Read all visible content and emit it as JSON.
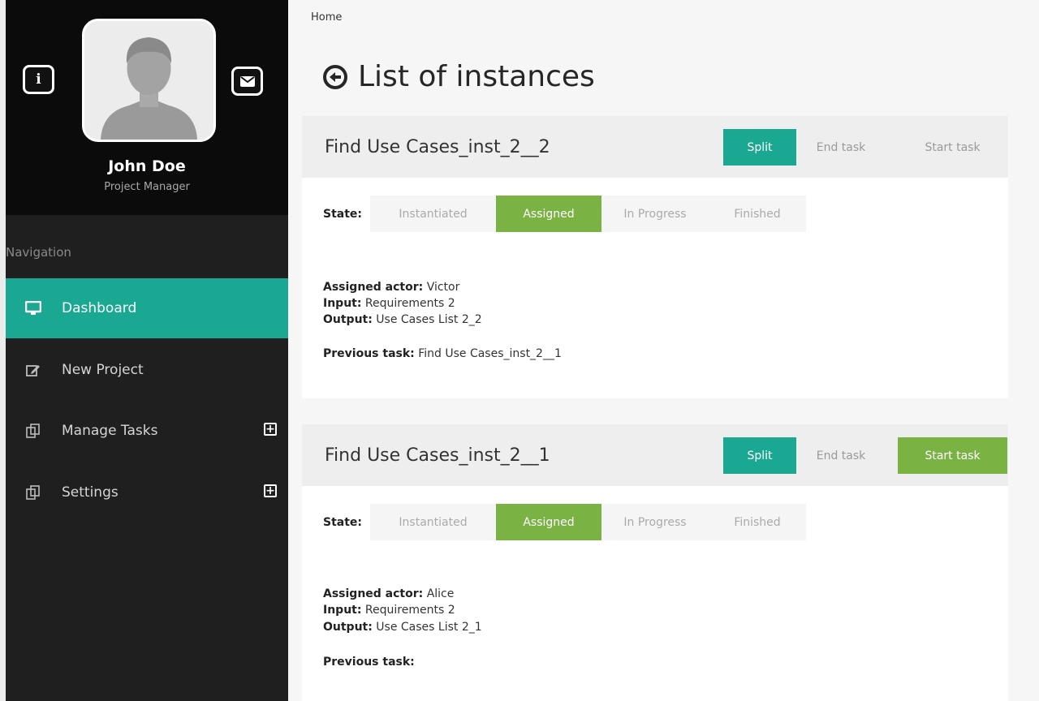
{
  "user": {
    "name": "John Doe",
    "role": "Project Manager"
  },
  "nav": {
    "heading": "Navigation",
    "items": [
      {
        "label": "Dashboard",
        "icon": "monitor-icon",
        "active": true
      },
      {
        "label": "New Project",
        "icon": "edit-icon"
      },
      {
        "label": "Manage Tasks",
        "icon": "copy-icon",
        "expandable": true
      },
      {
        "label": "Settings",
        "icon": "copy-icon",
        "expandable": true
      }
    ]
  },
  "breadcrumb": "Home",
  "page_title": "List of instances",
  "labels": {
    "state": "State:",
    "assigned_actor": "Assigned actor:",
    "input": "Input:",
    "output": "Output:",
    "previous_task": "Previous task:"
  },
  "states": [
    "Instantiated",
    "Assigned",
    "In Progress",
    "Finished"
  ],
  "instances": [
    {
      "title": "Find Use Cases_inst_2__2",
      "buttons": {
        "split": "Split",
        "end": "End task",
        "start": "Start task"
      },
      "current_state": "Assigned",
      "assigned_actor": "Victor",
      "input": "Requirements 2",
      "output": "Use Cases List 2_2",
      "previous_task": "Find Use Cases_inst_2__1"
    },
    {
      "title": "Find Use Cases_inst_2__1",
      "buttons": {
        "split": "Split",
        "end": "End task",
        "start": "Start task"
      },
      "current_state": "Assigned",
      "assigned_actor": "Alice",
      "input": "Requirements 2",
      "output": "Use Cases List 2_1",
      "previous_task": ""
    }
  ],
  "colors": {
    "teal": "#1aa893",
    "green": "#7ab244",
    "sidebar": "#1f1f1f"
  }
}
